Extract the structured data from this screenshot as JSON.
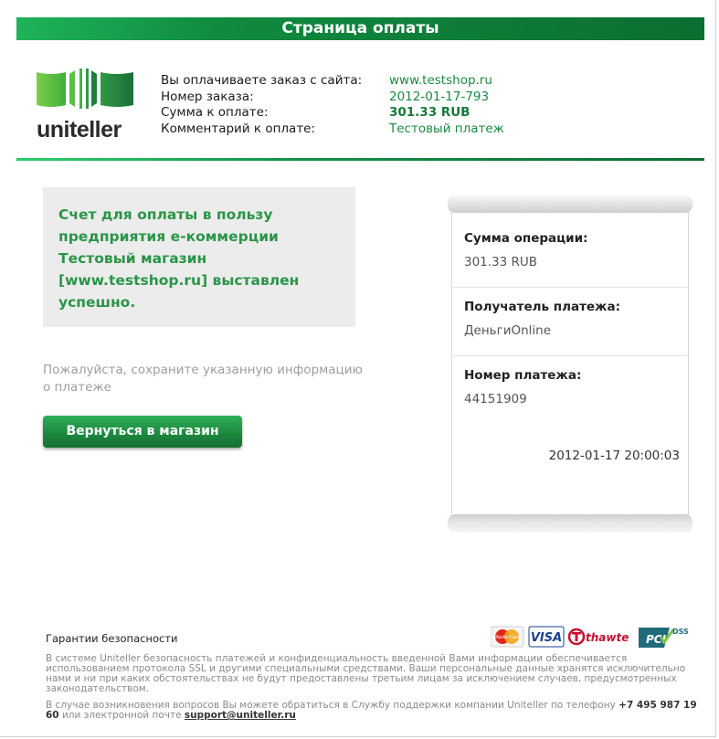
{
  "header": {
    "title": "Страница оплаты"
  },
  "logo": {
    "text": "uniteller"
  },
  "order_info": {
    "labels": [
      "Вы оплачиваете заказ с сайта:",
      "Номер заказа:",
      "Сумма к оплате:",
      "Комментарий к оплате:"
    ],
    "values": [
      "www.testshop.ru",
      "2012-01-17-793",
      "301.33 RUB",
      "Тестовый платеж"
    ]
  },
  "notice": {
    "text": "Счет для оплаты в пользу предприятия е-коммерции Тестовый магазин [www.testshop.ru] выставлен успешно."
  },
  "hint": {
    "text": "Пожалуйста, сохраните указанную информацию о платеже"
  },
  "return_button": {
    "label": "Вернуться в магазин"
  },
  "receipt": {
    "amount_label": "Сумма операции:",
    "amount_value": "301.33 RUB",
    "recipient_label": "Получатель платежа:",
    "recipient_value": "ДеньгиOnline",
    "payment_label": "Номер платежа:",
    "payment_value": "44151909",
    "datetime": "2012-01-17 20:00:03"
  },
  "footer": {
    "title": "Гарантии безопасности",
    "security_text": "В системе Uniteller безопасность платежей и конфиденциальность введенной Вами информации обеспечивается использованием протокола SSL и другими специальными средствами. Ваши персональные данные хранятся исключительно нами и ни при каких обстоятельствах не будут предоставлены третьим лицам за исключением случаев, предусмотренных законодательством.",
    "support_text_before": "В случае возникновения вопросов Вы можете обратиться в Службу поддержки компании Uniteller по телефону",
    "phone": "+7 495 987 19 60",
    "support_text_middle": "или электронной почте",
    "email": "support@uniteller.ru"
  },
  "badges": {
    "mastercard": "MasterCard",
    "visa": "VISA",
    "thawte": "thawte",
    "pci": "PCI",
    "dss": "DSS"
  },
  "colors": {
    "brand_green": "#0c6e32",
    "accent_green": "#1fb35a",
    "text_green": "#2a9548"
  }
}
